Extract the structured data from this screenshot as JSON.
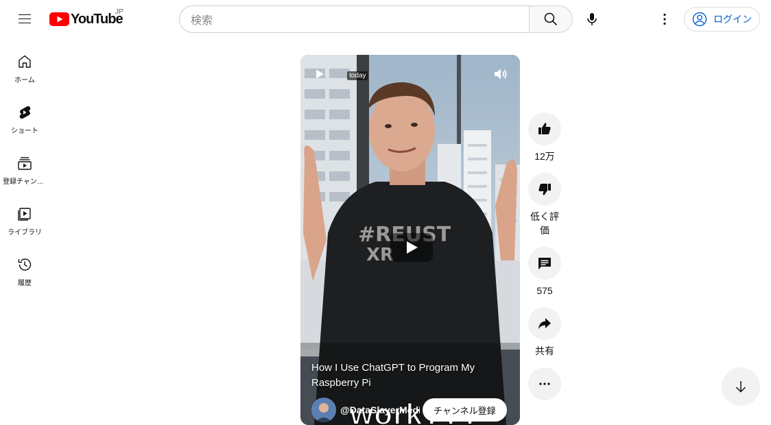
{
  "header": {
    "logo_text": "YouTube",
    "region": "JP",
    "search_placeholder": "検索",
    "login_label": "ログイン"
  },
  "sidebar": {
    "items": [
      {
        "label": "ホーム",
        "icon": "home-icon"
      },
      {
        "label": "ショート",
        "icon": "shorts-icon"
      },
      {
        "label": "登録チャンネル",
        "icon": "subscriptions-icon"
      },
      {
        "label": "ライブラリ",
        "icon": "library-icon"
      },
      {
        "label": "履歴",
        "icon": "history-icon"
      }
    ]
  },
  "player": {
    "badge": "today",
    "caption": "work???",
    "shirt_text_line1": "#REUST",
    "shirt_text_line2": "XR",
    "title": "How I Use ChatGPT to Program My Raspberry Pi",
    "channel": "@DataSlayerMedi",
    "subscribe_label": "チャンネル登録"
  },
  "actions": {
    "like_count": "12万",
    "dislike_label": "低く評価",
    "comment_count": "575",
    "share_label": "共有"
  },
  "colors": {
    "brand_red": "#ff0000",
    "link_blue": "#065fd4"
  }
}
